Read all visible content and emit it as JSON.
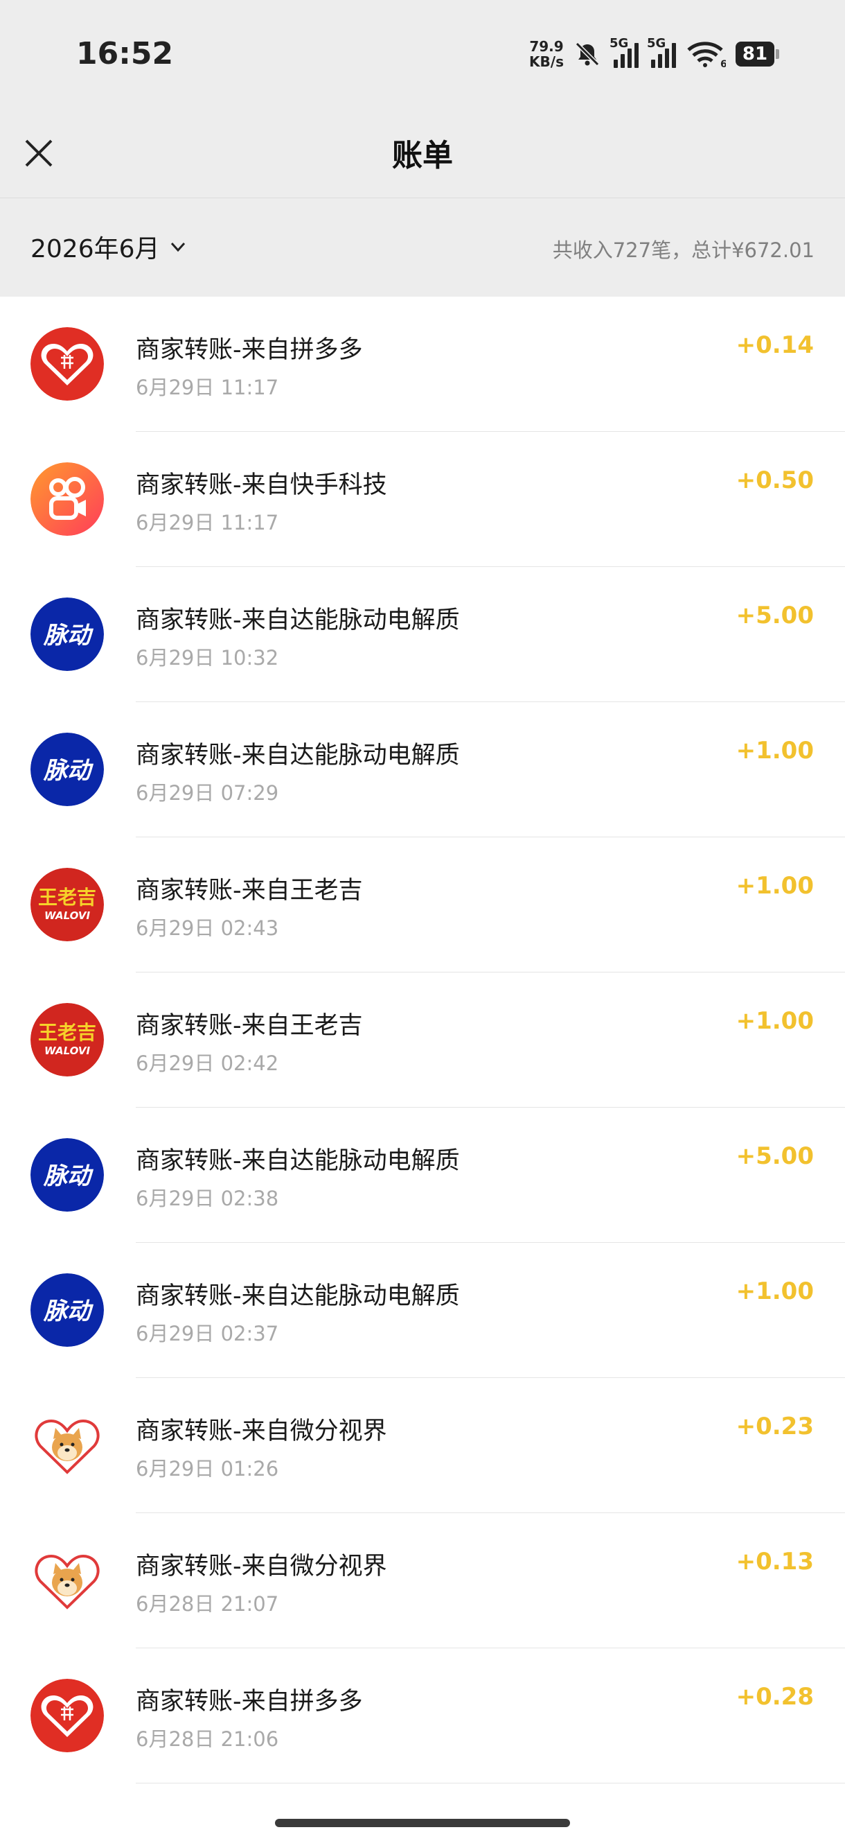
{
  "status_bar": {
    "time": "16:52",
    "net_speed_value": "79.9",
    "net_speed_unit": "KB/s",
    "signal1_label": "5G",
    "signal2_label": "5G",
    "wifi_label": "6",
    "battery": "81"
  },
  "header": {
    "title": "账单"
  },
  "summary": {
    "month": "2026年6月",
    "text": "共收入727笔，总计¥672.01"
  },
  "colors": {
    "amount": "#f2c12e",
    "background": "#ededed"
  },
  "transactions": [
    {
      "logo": "pinduoduo-logo",
      "title": "商家转账-来自拼多多",
      "date": "6月29日 11:17",
      "amount": "+0.14"
    },
    {
      "logo": "kuaishou-logo",
      "title": "商家转账-来自快手科技",
      "date": "6月29日 11:17",
      "amount": "+0.50"
    },
    {
      "logo": "mizone-logo",
      "title": "商家转账-来自达能脉动电解质",
      "date": "6月29日 10:32",
      "amount": "+5.00"
    },
    {
      "logo": "mizone-logo",
      "title": "商家转账-来自达能脉动电解质",
      "date": "6月29日 07:29",
      "amount": "+1.00"
    },
    {
      "logo": "wanglaoji-logo",
      "logo_text1": "王老吉",
      "logo_text2": "WALOVI",
      "title": "商家转账-来自王老吉",
      "date": "6月29日 02:43",
      "amount": "+1.00"
    },
    {
      "logo": "wanglaoji-logo",
      "logo_text1": "王老吉",
      "logo_text2": "WALOVI",
      "title": "商家转账-来自王老吉",
      "date": "6月29日 02:42",
      "amount": "+1.00"
    },
    {
      "logo": "mizone-logo",
      "title": "商家转账-来自达能脉动电解质",
      "date": "6月29日 02:38",
      "amount": "+5.00"
    },
    {
      "logo": "mizone-logo",
      "title": "商家转账-来自达能脉动电解质",
      "date": "6月29日 02:37",
      "amount": "+1.00"
    },
    {
      "logo": "doge-logo",
      "title": "商家转账-来自微分视界",
      "date": "6月29日 01:26",
      "amount": "+0.23"
    },
    {
      "logo": "doge-logo",
      "title": "商家转账-来自微分视界",
      "date": "6月28日 21:07",
      "amount": "+0.13"
    },
    {
      "logo": "pinduoduo-logo",
      "title": "商家转账-来自拼多多",
      "date": "6月28日 21:06",
      "amount": "+0.28"
    }
  ]
}
